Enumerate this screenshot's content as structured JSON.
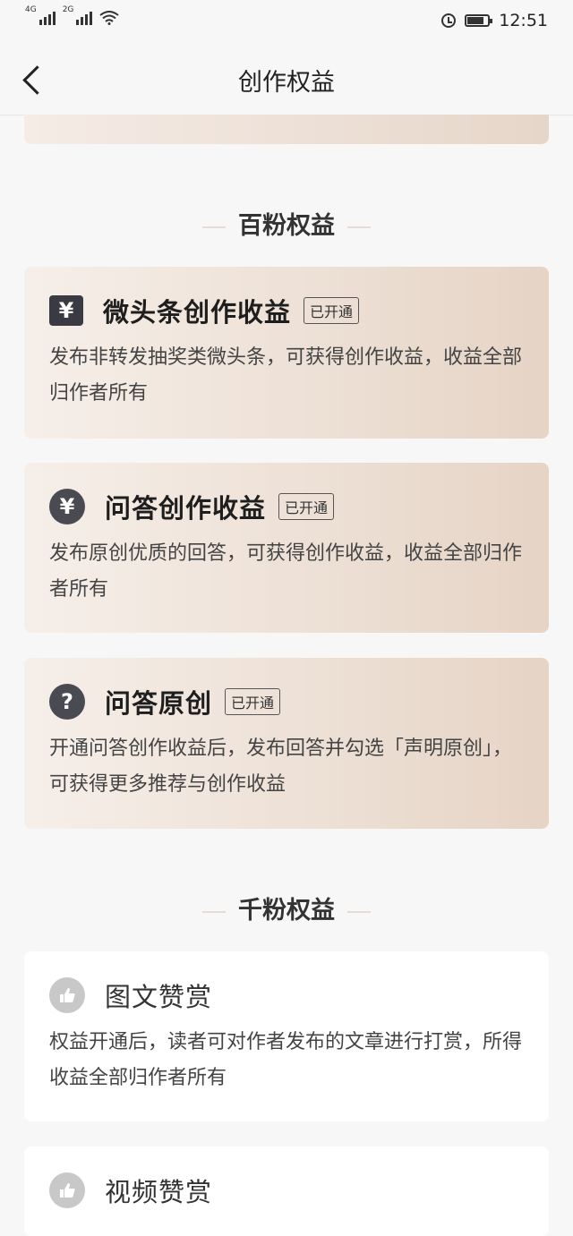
{
  "status_bar": {
    "signal1_label": "4G",
    "signal2_label": "2G",
    "time": "12:51",
    "battery_level": 0.8
  },
  "header": {
    "title": "创作权益"
  },
  "sections": [
    {
      "title": "百粉权益"
    },
    {
      "title": "千粉权益"
    }
  ],
  "cards": [
    {
      "icon": "yen-square-icon",
      "title": "微头条创作收益",
      "badge": "已开通",
      "desc": "发布非转发抽奖类微头条，可获得创作收益，收益全部归作者所有"
    },
    {
      "icon": "yen-chat-icon",
      "title": "问答创作收益",
      "badge": "已开通",
      "desc": "发布原创优质的回答，可获得创作收益，收益全部归作者所有"
    },
    {
      "icon": "question-chat-icon",
      "title": "问答原创",
      "badge": "已开通",
      "desc": "开通问答创作收益后，发布回答并勾选「声明原创」，可获得更多推荐与创作收益"
    },
    {
      "icon": "thumbs-up-icon",
      "title": "图文赞赏",
      "desc": "权益开通后，读者可对作者发布的文章进行打赏，所得收益全部归作者所有"
    },
    {
      "icon": "thumbs-up-icon",
      "title": "视频赞赏"
    }
  ],
  "colors": {
    "gold_start": "#f6efe9",
    "gold_end": "#e6d4c6",
    "icon_dark": "#3a3a42"
  }
}
